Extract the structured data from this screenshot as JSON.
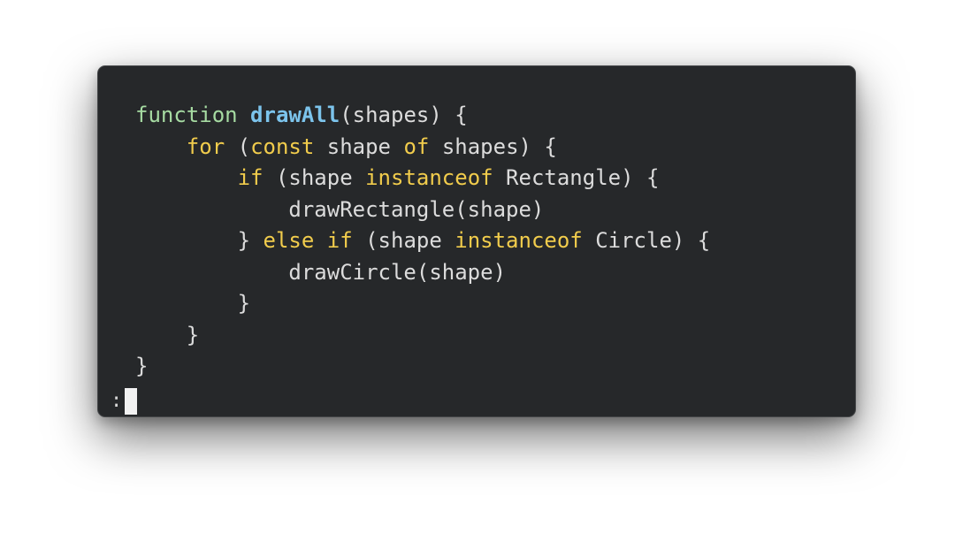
{
  "terminal": {
    "lines": [
      [
        {
          "t": "function ",
          "c": "tok-fn-kw"
        },
        {
          "t": "drawAll",
          "c": "tok-fn-name"
        },
        {
          "t": "(shapes) {",
          "c": "tok-plain"
        }
      ],
      [
        {
          "t": "    ",
          "c": "tok-plain"
        },
        {
          "t": "for",
          "c": "tok-kw"
        },
        {
          "t": " (",
          "c": "tok-plain"
        },
        {
          "t": "const",
          "c": "tok-kw"
        },
        {
          "t": " shape ",
          "c": "tok-plain"
        },
        {
          "t": "of",
          "c": "tok-kw"
        },
        {
          "t": " shapes) {",
          "c": "tok-plain"
        }
      ],
      [
        {
          "t": "        ",
          "c": "tok-plain"
        },
        {
          "t": "if",
          "c": "tok-kw"
        },
        {
          "t": " (shape ",
          "c": "tok-plain"
        },
        {
          "t": "instanceof",
          "c": "tok-kw"
        },
        {
          "t": " Rectangle) {",
          "c": "tok-plain"
        }
      ],
      [
        {
          "t": "            drawRectangle(shape)",
          "c": "tok-plain"
        }
      ],
      [
        {
          "t": "        } ",
          "c": "tok-plain"
        },
        {
          "t": "else if",
          "c": "tok-kw"
        },
        {
          "t": " (shape ",
          "c": "tok-plain"
        },
        {
          "t": "instanceof",
          "c": "tok-kw"
        },
        {
          "t": " Circle) {",
          "c": "tok-plain"
        }
      ],
      [
        {
          "t": "            drawCircle(shape)",
          "c": "tok-plain"
        }
      ],
      [
        {
          "t": "        }",
          "c": "tok-plain"
        }
      ],
      [
        {
          "t": "    }",
          "c": "tok-plain"
        }
      ],
      [
        {
          "t": "}",
          "c": "tok-plain"
        }
      ]
    ],
    "prompt": ":"
  },
  "colors": {
    "background": "#26282a",
    "function_keyword": "#a6dba2",
    "function_name": "#7cc4ec",
    "keyword": "#f1cc4c",
    "plain": "#dcdcdc",
    "cursor": "#f2f2f2"
  },
  "icons": {
    "cursor": "block-cursor-icon"
  }
}
